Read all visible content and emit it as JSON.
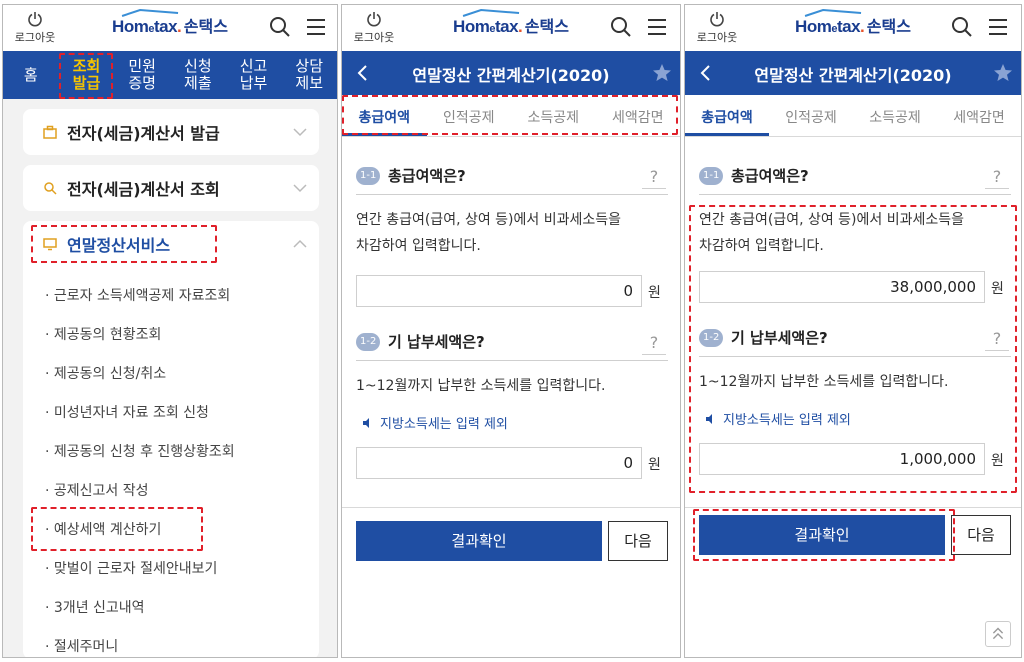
{
  "header": {
    "logout_label": "로그아웃",
    "logo_en_prefix": "Hom",
    "logo_en_small_e": "e",
    "logo_en_suffix": "tax",
    "logo_dot": ".",
    "logo_ko": "손택스"
  },
  "main_nav": [
    {
      "line1": "홈",
      "line2": ""
    },
    {
      "line1": "조회",
      "line2": "발급"
    },
    {
      "line1": "민원",
      "line2": "증명"
    },
    {
      "line1": "신청",
      "line2": "제출"
    },
    {
      "line1": "신고",
      "line2": "납부"
    },
    {
      "line1": "상담",
      "line2": "제보"
    }
  ],
  "menu": {
    "item1": "전자(세금)계산서 발급",
    "item2": "전자(세금)계산서 조회",
    "item3": "연말정산서비스",
    "sub_items": [
      "· 근로자 소득세액공제 자료조회",
      "· 제공동의 현황조회",
      "· 제공동의 신청/취소",
      "· 미성년자녀 자료 조회 신청",
      "· 제공동의 신청 후 진행상황조회",
      "· 공제신고서 작성",
      "· 예상세액 계산하기",
      "· 맞벌이 근로자 절세안내보기",
      "· 3개년 신고내역",
      "· 절세주머니"
    ]
  },
  "calc": {
    "title": "연말정산 간편계산기(2020)",
    "tabs": [
      "총급여액",
      "인적공제",
      "소득공제",
      "세액감면"
    ],
    "q1_badge": "1-1",
    "q1_label": "총급여액은?",
    "q1_desc_line1": "연간 총급여(급여, 상여 등)에서 비과세소득을",
    "q1_desc_line2": "차감하여 입력합니다.",
    "q2_badge": "1-2",
    "q2_label": "기 납부세액은?",
    "q2_desc": "1~12월까지 납부한 소득세를 입력합니다.",
    "q2_note": "지방소득세는 입력 제외",
    "help": "?",
    "unit": "원",
    "result_button": "결과확인",
    "next_button": "다음"
  },
  "panel2_values": {
    "salary": "0",
    "tax_paid": "0"
  },
  "panel3_values": {
    "salary": "38,000,000",
    "tax_paid": "1,000,000"
  },
  "colors": {
    "brand_blue": "#1f4ea3",
    "highlight_red": "#e0202a",
    "active_nav": "#f5c400"
  }
}
